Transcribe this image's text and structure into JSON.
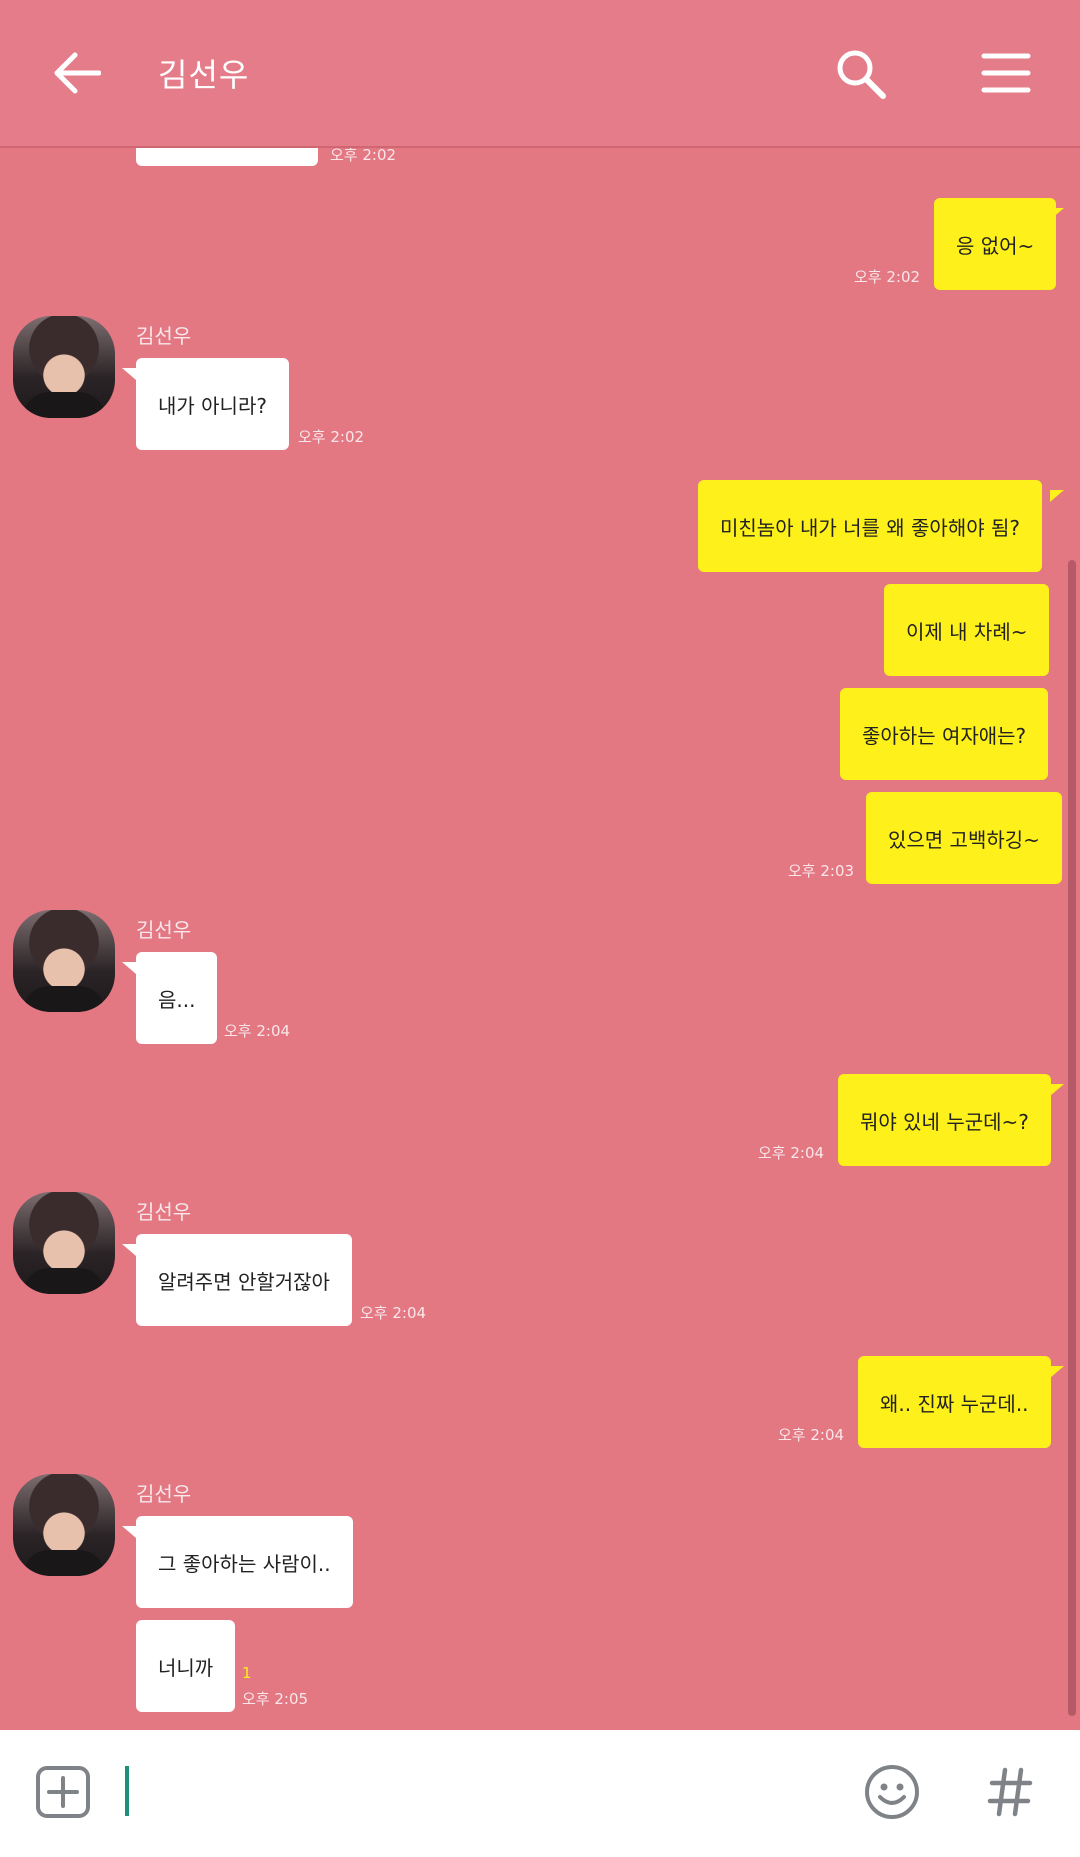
{
  "header": {
    "title": "김선우",
    "back_icon": "arrow-left-icon",
    "search_icon": "search-icon",
    "menu_icon": "hamburger-menu-icon",
    "bg_color": "#e47d89"
  },
  "colors": {
    "chat_bg": "#e37883",
    "my_bubble": "#fef01b",
    "other_bubble": "#ffffff"
  },
  "messages": [
    {
      "sender": "other",
      "name": "",
      "text": "",
      "time": "오후 2:02"
    },
    {
      "sender": "me",
      "text": "응 없어~",
      "time": "오후 2:02"
    },
    {
      "sender": "other",
      "name": "김선우",
      "text": "내가 아니라?",
      "time": "오후 2:02"
    },
    {
      "sender": "me",
      "text": "미친놈아 내가 너를 왜 좋아해야 됨?",
      "time": ""
    },
    {
      "sender": "me",
      "text": "이제 내 차례~",
      "time": ""
    },
    {
      "sender": "me",
      "text": "좋아하는 여자애는?",
      "time": ""
    },
    {
      "sender": "me",
      "text": "있으면 고백하깅~",
      "time": "오후 2:03"
    },
    {
      "sender": "other",
      "name": "김선우",
      "text": "음...",
      "time": "오후 2:04"
    },
    {
      "sender": "me",
      "text": "뭐야 있네 누군데~?",
      "time": "오후 2:04"
    },
    {
      "sender": "other",
      "name": "김선우",
      "text": "알려주면 안할거잖아",
      "time": "오후 2:04"
    },
    {
      "sender": "me",
      "text": "왜.. 진짜 누군데..",
      "time": "오후 2:04"
    },
    {
      "sender": "other",
      "name": "김선우",
      "text": "그 좋아하는 사람이..",
      "time": ""
    },
    {
      "sender": "other",
      "name": "",
      "text": "너니까",
      "unread": "1",
      "time": "오후 2:05"
    }
  ],
  "input_bar": {
    "add_icon": "plus-square-icon",
    "emoji_icon": "smiley-icon",
    "hash_icon": "hash-icon",
    "value": ""
  }
}
